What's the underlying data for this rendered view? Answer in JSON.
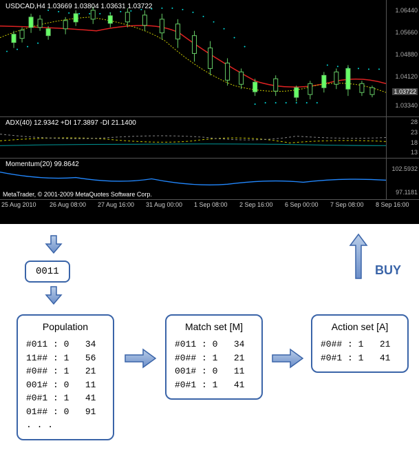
{
  "chart": {
    "symbol_header": "USDCAD,H4  1.03669 1.03804 1.03631 1.03722",
    "adx_header": "ADX(40) 12.9342 +DI 17.3897 -DI 21.1400",
    "mom_header": "Momentum(20) 99.8642",
    "copyright": "MetaTrader, © 2001-2009 MetaQuotes Software Corp.",
    "current_price": "1.03722",
    "y_main": [
      "1.06440",
      "1.05660",
      "1.04880",
      "1.04120",
      "1.03340"
    ],
    "y_adx": [
      "28",
      "23",
      "18",
      "13"
    ],
    "y_mom": [
      "102.5932",
      "97.1181"
    ],
    "x_axis": [
      "25 Aug 2010",
      "26 Aug 08:00",
      "27 Aug 16:00",
      "31 Aug 00:00",
      "1 Sep 08:00",
      "2 Sep 16:00",
      "6 Sep 00:00",
      "7 Sep 08:00",
      "8 Sep 16:00"
    ]
  },
  "diagram": {
    "input_box": "0011",
    "buy_label": "BUY",
    "population": {
      "title": "Population",
      "rows": [
        "#011 : 0   34",
        "11## : 1   56",
        "#0## : 1   21",
        "001# : 0   11",
        "#0#1 : 1   41",
        "01## : 0   91",
        ". . ."
      ]
    },
    "match_set": {
      "title": "Match set [M]",
      "rows": [
        "#011 : 0   34",
        "#0## : 1   21",
        "001# : 0   11",
        "#0#1 : 1   41"
      ]
    },
    "action_set": {
      "title": "Action set [A]",
      "rows": [
        "#0## : 1   21",
        "#0#1 : 1   41"
      ]
    }
  },
  "chart_data": {
    "type": "diagram",
    "note": "Composite image: top = MetaTrader forex chart (candlesticks + moving averages + Parabolic SAR dots, ADX(40) indicator, Momentum(20) indicator). Bottom = XCS / learning classifier system flow diagram.",
    "forex_chart": {
      "symbol": "USDCAD",
      "timeframe": "H4",
      "ohlc_latest": {
        "open": 1.03669,
        "high": 1.03804,
        "low": 1.03631,
        "close": 1.03722
      },
      "price_axis_range": [
        1.0334,
        1.0644
      ],
      "price_axis_ticks": [
        1.0644,
        1.0566,
        1.0488,
        1.0412,
        1.0334
      ],
      "indicators": {
        "ADX": {
          "period": 40,
          "adx": 12.9342,
          "plus_di": 17.3897,
          "minus_di": 21.14,
          "axis_ticks": [
            28,
            23,
            18,
            13
          ]
        },
        "Momentum": {
          "period": 20,
          "value": 99.8642,
          "axis_ticks": [
            102.5932,
            97.1181
          ]
        }
      },
      "time_axis": [
        "25 Aug 2010",
        "26 Aug 08:00",
        "27 Aug 16:00",
        "31 Aug 00:00",
        "1 Sep 08:00",
        "2 Sep 16:00",
        "6 Sep 00:00",
        "7 Sep 08:00",
        "8 Sep 16:00"
      ]
    },
    "classifier_flow": {
      "input_condition": "0011",
      "output_action": "BUY",
      "population": [
        {
          "condition": "#011",
          "action": 0,
          "param": 34
        },
        {
          "condition": "11##",
          "action": 1,
          "param": 56
        },
        {
          "condition": "#0##",
          "action": 1,
          "param": 21
        },
        {
          "condition": "001#",
          "action": 0,
          "param": 11
        },
        {
          "condition": "#0#1",
          "action": 1,
          "param": 41
        },
        {
          "condition": "01##",
          "action": 0,
          "param": 91
        }
      ],
      "match_set": [
        {
          "condition": "#011",
          "action": 0,
          "param": 34
        },
        {
          "condition": "#0##",
          "action": 1,
          "param": 21
        },
        {
          "condition": "001#",
          "action": 0,
          "param": 11
        },
        {
          "condition": "#0#1",
          "action": 1,
          "param": 41
        }
      ],
      "action_set": [
        {
          "condition": "#0##",
          "action": 1,
          "param": 21
        },
        {
          "condition": "#0#1",
          "action": 1,
          "param": 41
        }
      ]
    }
  }
}
